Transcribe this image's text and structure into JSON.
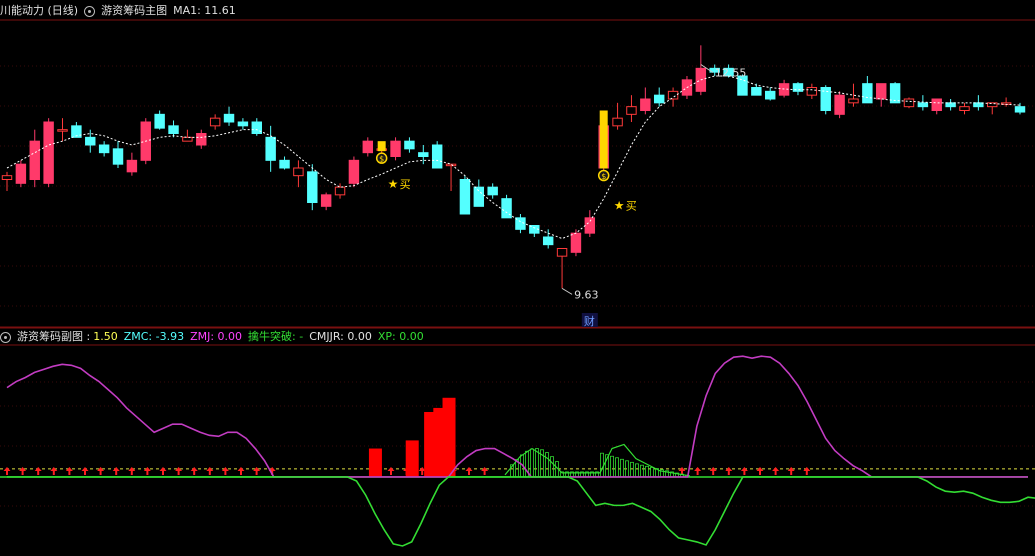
{
  "main_header": {
    "title": "川能动力 (日线)",
    "indicator": "游资筹码主图",
    "ma_label": "MA1: 11.61"
  },
  "sub_header": {
    "indicator": "游资筹码副图 :",
    "value": "1.50",
    "zmc": "ZMC: -3.93",
    "zmj": "ZMJ: 0.00",
    "qnt": "擒牛突破: -",
    "cmjjr": "CMJJR: 0.00",
    "xp": "XP: 0.00"
  },
  "colors": {
    "up": "#ff3a6a",
    "up_hollow": "#ff3a3a",
    "down": "#54ffff",
    "ma": "#ffffff",
    "zmc": "#c23cc2",
    "green": "#33dd33",
    "red_bar": "#ff0000",
    "signal": "#ffd700"
  },
  "markers": {
    "high_label": "12.55",
    "low_label": "9.63",
    "buy_label": "买",
    "cai_label": "财"
  },
  "chart_data": [
    {
      "type": "candlestick",
      "ylim": [
        9.4,
        13.0
      ],
      "candles": [
        [
          11.05,
          11.15,
          10.9,
          11.1
        ],
        [
          11.0,
          11.3,
          10.95,
          11.25
        ],
        [
          11.05,
          11.7,
          10.95,
          11.55
        ],
        [
          11.0,
          11.85,
          10.95,
          11.8
        ],
        [
          11.7,
          11.85,
          11.55,
          11.7
        ],
        [
          11.75,
          11.8,
          11.6,
          11.6
        ],
        [
          11.6,
          11.7,
          11.4,
          11.5
        ],
        [
          11.5,
          11.55,
          11.35,
          11.4
        ],
        [
          11.45,
          11.55,
          11.2,
          11.25
        ],
        [
          11.15,
          11.4,
          11.1,
          11.3
        ],
        [
          11.3,
          11.85,
          11.25,
          11.8
        ],
        [
          11.9,
          11.95,
          11.7,
          11.72
        ],
        [
          11.75,
          11.82,
          11.6,
          11.65
        ],
        [
          11.55,
          11.7,
          11.55,
          11.6
        ],
        [
          11.5,
          11.7,
          11.45,
          11.65
        ],
        [
          11.75,
          11.9,
          11.7,
          11.85
        ],
        [
          11.9,
          12.0,
          11.75,
          11.8
        ],
        [
          11.8,
          11.85,
          11.7,
          11.75
        ],
        [
          11.8,
          11.85,
          11.62,
          11.65
        ],
        [
          11.6,
          11.75,
          11.15,
          11.3
        ],
        [
          11.3,
          11.35,
          11.18,
          11.2
        ],
        [
          11.1,
          11.3,
          10.95,
          11.2
        ],
        [
          11.15,
          11.25,
          10.65,
          10.75
        ],
        [
          10.7,
          10.88,
          10.65,
          10.85
        ],
        [
          10.85,
          11.0,
          10.8,
          10.95
        ],
        [
          11.0,
          11.35,
          10.95,
          11.3
        ],
        [
          11.4,
          11.6,
          11.35,
          11.55
        ],
        [
          11.45,
          11.5,
          11.4,
          11.45
        ],
        [
          11.35,
          11.6,
          11.3,
          11.55
        ],
        [
          11.55,
          11.6,
          11.4,
          11.45
        ],
        [
          11.4,
          11.5,
          11.25,
          11.35
        ],
        [
          11.5,
          11.55,
          11.2,
          11.2
        ],
        [
          11.25,
          11.25,
          10.9,
          11.25
        ],
        [
          11.05,
          11.1,
          10.6,
          10.6
        ],
        [
          10.95,
          11.05,
          10.7,
          10.7
        ],
        [
          10.95,
          11.0,
          10.8,
          10.85
        ],
        [
          10.8,
          10.85,
          10.55,
          10.55
        ],
        [
          10.55,
          10.6,
          10.35,
          10.4
        ],
        [
          10.45,
          10.45,
          10.3,
          10.35
        ],
        [
          10.3,
          10.4,
          10.15,
          10.2
        ],
        [
          10.05,
          10.15,
          9.63,
          10.15
        ],
        [
          10.1,
          10.4,
          10.05,
          10.35
        ],
        [
          10.35,
          10.65,
          10.3,
          10.55
        ],
        [
          11.2,
          11.95,
          11.15,
          11.75
        ],
        [
          11.75,
          12.05,
          11.7,
          11.85
        ],
        [
          11.9,
          12.15,
          11.8,
          12.0
        ],
        [
          11.95,
          12.25,
          11.9,
          12.1
        ],
        [
          12.15,
          12.25,
          12.0,
          12.05
        ],
        [
          12.1,
          12.25,
          12.0,
          12.2
        ],
        [
          12.15,
          12.4,
          12.1,
          12.35
        ],
        [
          12.2,
          12.8,
          12.15,
          12.5
        ],
        [
          12.5,
          12.55,
          12.4,
          12.45
        ],
        [
          12.5,
          12.55,
          12.38,
          12.4
        ],
        [
          12.4,
          12.42,
          12.15,
          12.15
        ],
        [
          12.25,
          12.3,
          12.15,
          12.15
        ],
        [
          12.2,
          12.25,
          12.08,
          12.1
        ],
        [
          12.15,
          12.35,
          12.12,
          12.3
        ],
        [
          12.3,
          12.32,
          12.15,
          12.2
        ],
        [
          12.15,
          12.3,
          12.1,
          12.25
        ],
        [
          12.25,
          12.28,
          11.9,
          11.95
        ],
        [
          11.9,
          12.2,
          11.85,
          12.15
        ],
        [
          12.05,
          12.3,
          12.0,
          12.1
        ],
        [
          12.3,
          12.4,
          12.05,
          12.05
        ],
        [
          12.1,
          12.3,
          12.0,
          12.3
        ],
        [
          12.3,
          12.32,
          12.05,
          12.05
        ],
        [
          12.0,
          12.12,
          11.98,
          12.1
        ],
        [
          12.05,
          12.15,
          11.95,
          12.0
        ],
        [
          11.95,
          12.1,
          11.9,
          12.1
        ],
        [
          12.05,
          12.1,
          11.95,
          12.0
        ],
        [
          11.95,
          12.05,
          11.9,
          12.0
        ],
        [
          12.05,
          12.15,
          11.95,
          12.0
        ],
        [
          12.0,
          12.05,
          11.9,
          12.05
        ],
        [
          12.05,
          12.12,
          12.0,
          12.05
        ],
        [
          12.0,
          12.05,
          11.9,
          11.93
        ]
      ],
      "ma1": [
        11.2,
        11.3,
        11.4,
        11.5,
        11.55,
        11.62,
        11.65,
        11.62,
        11.55,
        11.5,
        11.55,
        11.6,
        11.62,
        11.6,
        11.6,
        11.62,
        11.66,
        11.7,
        11.7,
        11.62,
        11.5,
        11.35,
        11.2,
        11.05,
        10.95,
        10.97,
        11.05,
        11.12,
        11.2,
        11.28,
        11.3,
        11.3,
        11.25,
        11.1,
        10.9,
        10.75,
        10.62,
        10.5,
        10.42,
        10.35,
        10.28,
        10.35,
        10.5,
        10.8,
        11.15,
        11.5,
        11.8,
        12.0,
        12.12,
        12.25,
        12.35,
        12.4,
        12.4,
        12.35,
        12.28,
        12.25,
        12.23,
        12.22,
        12.22,
        12.2,
        12.18,
        12.15,
        12.12,
        12.1,
        12.08,
        12.07,
        12.06,
        12.05,
        12.05,
        12.05,
        12.05,
        12.04,
        12.03,
        12.02
      ],
      "high": 12.55,
      "low": 9.63,
      "buy_signals": [
        27,
        43
      ]
    },
    {
      "type": "line",
      "ylim": [
        -3.5,
        6.5
      ],
      "zmc": [
        4.4,
        4.7,
        4.9,
        5.15,
        5.3,
        5.45,
        5.55,
        5.5,
        5.35,
        5.0,
        4.7,
        4.3,
        3.9,
        3.4,
        3.0,
        2.6,
        2.2,
        2.4,
        2.6,
        2.6,
        2.4,
        2.2,
        2.05,
        2.0,
        2.2,
        2.2,
        1.9,
        1.4,
        0.8,
        0.0,
        0.0,
        0.0,
        0.0,
        0.0,
        0.0,
        0.0,
        0.0,
        0.0,
        0.0,
        0.0,
        0.0,
        0.0,
        0.0,
        0.0,
        0.0,
        0.0,
        0.0,
        0.0,
        0.0,
        0.6,
        1.0,
        1.3,
        1.4,
        1.4,
        1.15,
        0.9,
        0.6,
        0.0,
        0.0,
        0.0,
        0.0,
        0.0,
        0.0,
        0.0,
        0.0,
        0.0,
        0.0,
        0.0,
        0.0,
        0.0,
        0.0,
        0.0,
        0.0,
        0.0,
        0.0,
        2.5,
        4.0,
        5.1,
        5.6,
        5.9,
        5.95,
        5.85,
        5.95,
        5.9,
        5.6,
        5.1,
        4.5,
        3.7,
        2.8,
        1.9,
        1.3,
        0.9,
        0.55,
        0.3,
        0.0,
        0.0,
        0.0,
        0.0,
        0.0,
        0.0,
        0.0,
        0.0,
        0.0,
        0.0,
        0.0,
        0.0,
        0.0,
        0.0,
        0.0,
        0.0,
        0.0,
        0.0
      ],
      "green": [
        0.0,
        0.0,
        0.0,
        0.0,
        0.0,
        0.0,
        0.0,
        0.0,
        0.0,
        0.0,
        0.0,
        0.0,
        0.0,
        0.0,
        0.0,
        0.0,
        0.0,
        0.0,
        0.0,
        0.0,
        0.0,
        0.0,
        0.0,
        0.0,
        0.0,
        0.0,
        0.0,
        0.0,
        0.0,
        0.0,
        0.0,
        0.0,
        0.0,
        0.0,
        0.0,
        0.0,
        0.0,
        0.0,
        -0.2,
        -0.9,
        -1.8,
        -2.6,
        -3.3,
        -3.4,
        -3.2,
        -2.3,
        -1.3,
        -0.4,
        0.0,
        0.0,
        0.0,
        0.0,
        0.0,
        0.0,
        0.0,
        0.0,
        0.0,
        0.0,
        0.0,
        0.0,
        0.0,
        0.0,
        -0.2,
        -0.8,
        -1.4,
        -1.3,
        -1.4,
        -1.4,
        -1.3,
        -1.5,
        -1.7,
        -2.1,
        -2.6,
        -3.0,
        -3.1,
        -3.2,
        -3.35,
        -2.6,
        -1.7,
        -0.8,
        0.0,
        0.0,
        0.0,
        0.0,
        0.0,
        0.0,
        0.0,
        0.0,
        0.0,
        0.0,
        0.0,
        0.0,
        0.0,
        0.0,
        0.0,
        0.0,
        0.0,
        0.0,
        0.0,
        0.0,
        -0.2,
        -0.5,
        -0.7,
        -0.75,
        -0.7,
        -0.8,
        -1.0,
        -1.15,
        -1.25,
        -1.25,
        -1.2,
        -1.0,
        -1.05,
        -1.1,
        -1.0,
        -1.0,
        -1.05,
        -1.1
      ],
      "dashed_level": 0.4,
      "red_bars": [
        [
          40,
          1.4
        ],
        [
          44,
          1.8
        ],
        [
          46,
          3.2
        ],
        [
          47,
          3.4
        ],
        [
          48,
          3.9
        ]
      ]
    }
  ]
}
